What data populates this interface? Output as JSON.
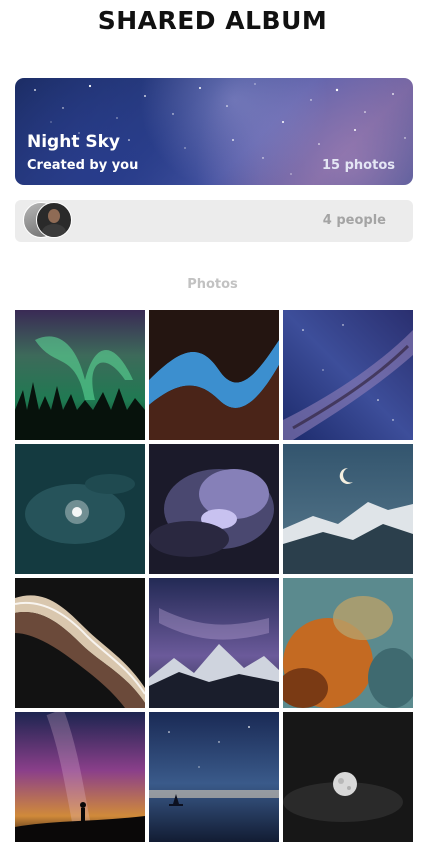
{
  "header": {
    "title": "SHARED ALBUM"
  },
  "album": {
    "name": "Night Sky",
    "creator": "Created by you",
    "photo_count": "15 photos"
  },
  "people": {
    "count": "4 people"
  },
  "photos_section": {
    "label": "Photos"
  },
  "photos": [
    {
      "subject": "aurora over forest"
    },
    {
      "subject": "slot canyon with blue sky"
    },
    {
      "subject": "milky way"
    },
    {
      "subject": "moon behind clouds"
    },
    {
      "subject": "lightning in storm cloud"
    },
    {
      "subject": "crescent moon over snowy mountains"
    },
    {
      "subject": "marbled agate pattern"
    },
    {
      "subject": "milky way over mountains"
    },
    {
      "subject": "orange nebula"
    },
    {
      "subject": "silhouette under milky way"
    },
    {
      "subject": "sailboat under starry sky"
    },
    {
      "subject": "full moon in dark clouds"
    }
  ],
  "colors": {
    "album_text": "#ffffff",
    "muted_text": "#a4a4a4",
    "people_bar": "#ececec"
  }
}
